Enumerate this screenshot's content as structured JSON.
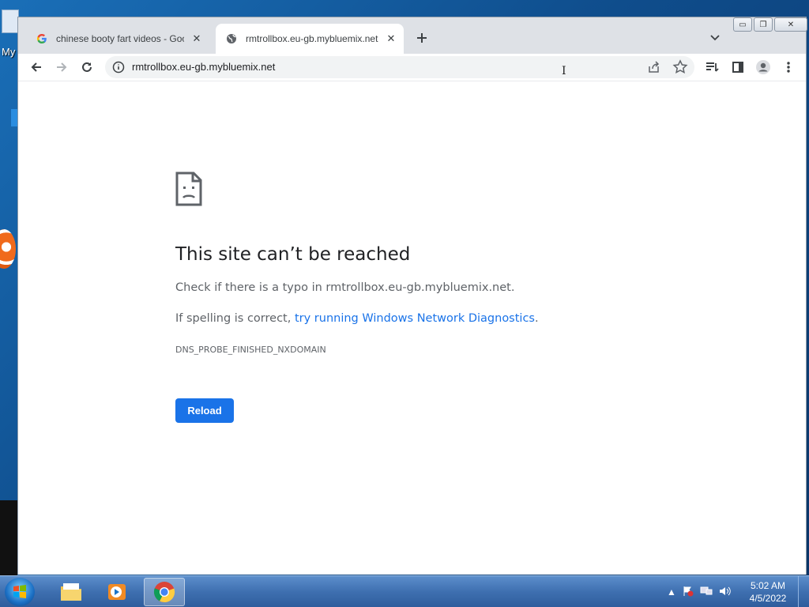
{
  "desktop": {
    "icon_label": "My"
  },
  "browser": {
    "tabs": [
      {
        "title": "chinese booty fart videos - Goog",
        "favicon": "google-g-icon",
        "active": false
      },
      {
        "title": "rmtrollbox.eu-gb.mybluemix.net",
        "favicon": "globe-icon",
        "active": true
      }
    ],
    "tab_close_glyph": "✕",
    "new_tab_glyph": "+",
    "window_controls": {
      "minimize": "▭",
      "maximize": "❐",
      "close": "✕"
    },
    "address": {
      "url": "rmtrollbox.eu-gb.mybluemix.net"
    }
  },
  "error_page": {
    "heading": "This site can’t be reached",
    "typo_text": "Check if there is a typo in rmtrollbox.eu-gb.mybluemix.net.",
    "spelling_prefix": "If spelling is correct, ",
    "diagnostics_link": "try running Windows Network Diagnostics",
    "spelling_suffix": ".",
    "error_code": "DNS_PROBE_FINISHED_NXDOMAIN",
    "reload_label": "Reload"
  },
  "taskbar": {
    "apps": [
      "file-explorer-icon",
      "media-player-icon",
      "chrome-icon"
    ],
    "clock_time": "5:02 AM",
    "clock_date": "4/5/2022"
  },
  "colors": {
    "accent": "#1a73e8",
    "tabstrip": "#dee1e6"
  }
}
